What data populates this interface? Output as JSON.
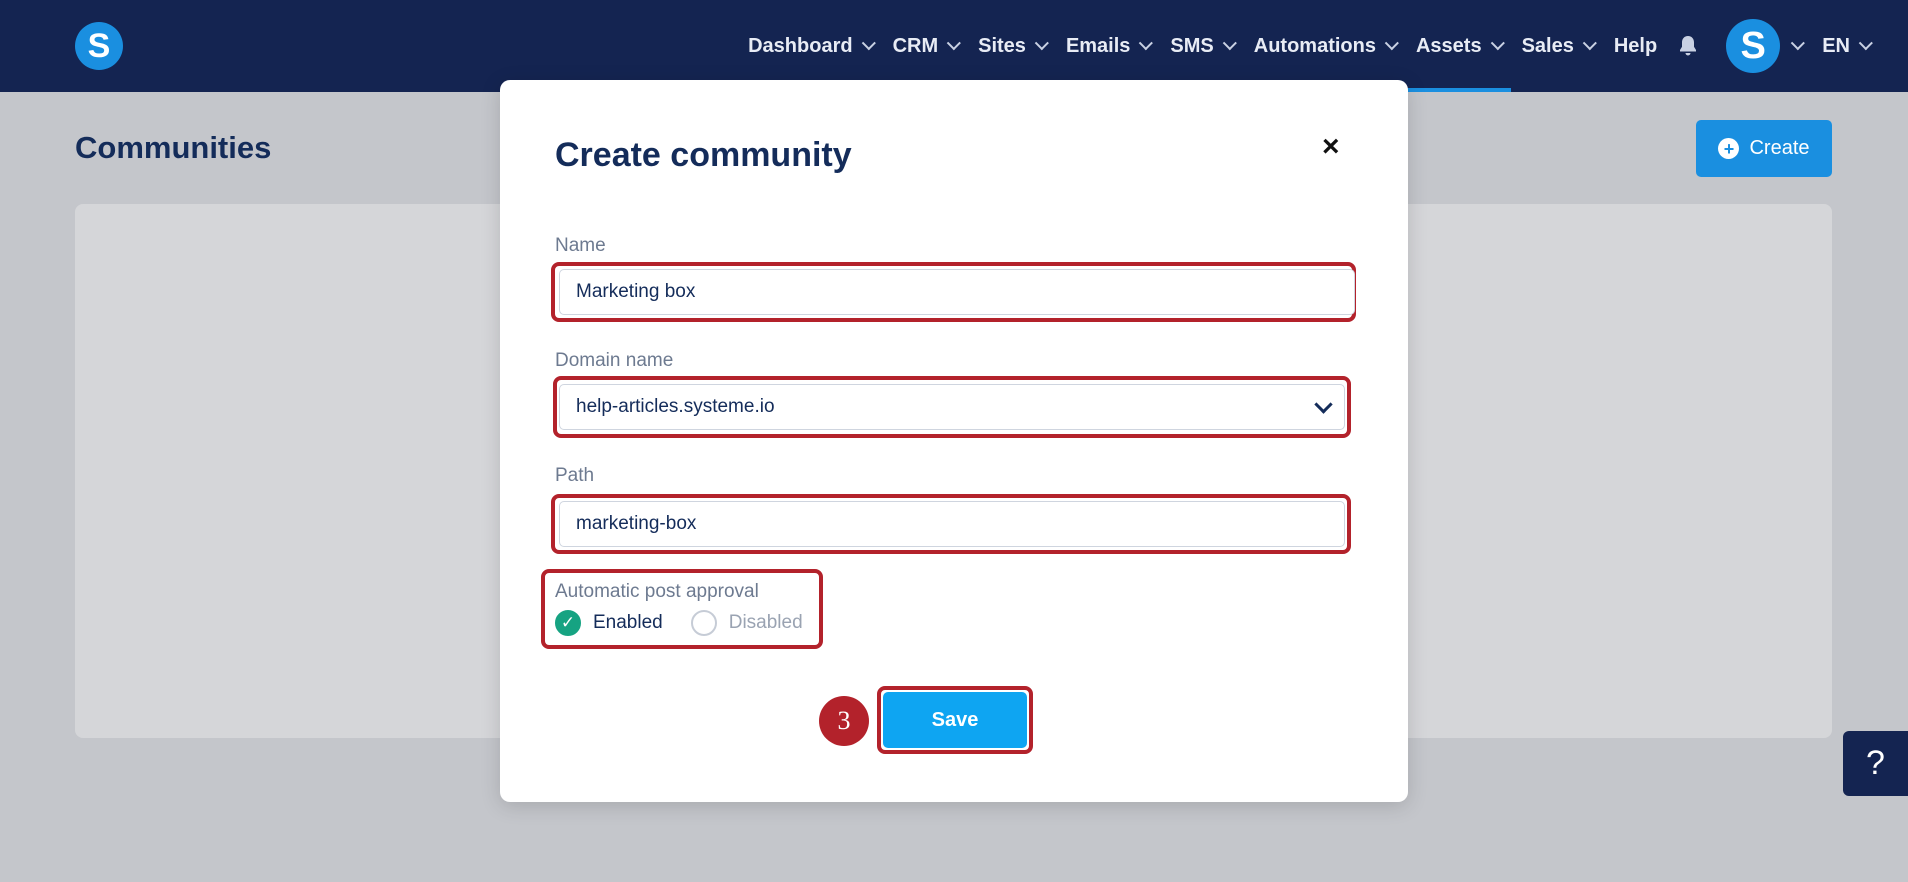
{
  "app": {
    "logo_letter": "S"
  },
  "nav": {
    "items": [
      {
        "label": "Dashboard",
        "has_chevron": true
      },
      {
        "label": "CRM",
        "has_chevron": true
      },
      {
        "label": "Sites",
        "has_chevron": true
      },
      {
        "label": "Emails",
        "has_chevron": true
      },
      {
        "label": "SMS",
        "has_chevron": true
      },
      {
        "label": "Automations",
        "has_chevron": true
      },
      {
        "label": "Assets",
        "has_chevron": true,
        "active": true
      },
      {
        "label": "Sales",
        "has_chevron": true
      },
      {
        "label": "Help",
        "has_chevron": false
      }
    ],
    "bell_icon": "bell-icon",
    "avatar_letter": "S",
    "language": "EN"
  },
  "page": {
    "title": "Communities",
    "create_label": "Create"
  },
  "help_fab": {
    "label": "?"
  },
  "modal": {
    "title": "Create community",
    "close_label": "×",
    "name": {
      "label": "Name",
      "value": "Marketing box"
    },
    "domain": {
      "label": "Domain name",
      "value": "help-articles.systeme.io"
    },
    "path": {
      "label": "Path",
      "value": "marketing-box"
    },
    "approval": {
      "label": "Automatic post approval",
      "options": [
        {
          "label": "Enabled",
          "selected": true
        },
        {
          "label": "Disabled",
          "selected": false
        }
      ]
    },
    "save_label": "Save",
    "step_number": "3"
  },
  "colors": {
    "navbar": "#142451",
    "brand_blue": "#1a8fe0",
    "save_blue": "#0ea5f2",
    "highlight_red": "#b3222b",
    "radio_green": "#16a382"
  }
}
